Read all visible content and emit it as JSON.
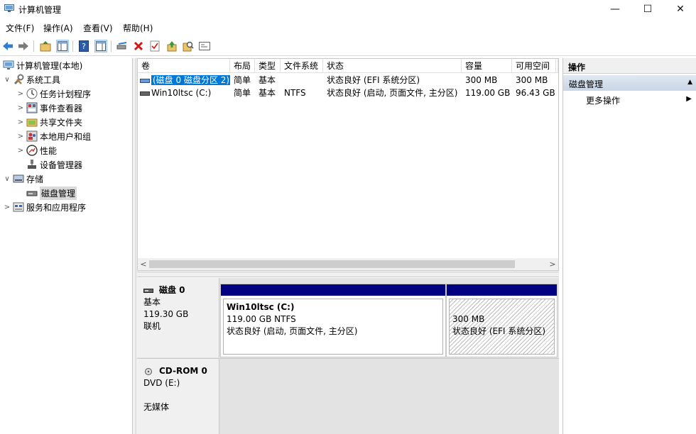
{
  "window": {
    "title": "计算机管理",
    "controls": {
      "minimize": "—",
      "maximize": "☐",
      "close": "✕"
    }
  },
  "menu": [
    "文件(F)",
    "操作(A)",
    "查看(V)",
    "帮助(H)"
  ],
  "toolbar": {
    "icons": [
      "back-icon",
      "forward-icon",
      "up-folder-icon",
      "show-hide-tree-icon",
      "help-icon",
      "properties-pane-icon",
      "connect-icon",
      "delete-icon",
      "check-icon",
      "import-icon",
      "search-icon",
      "console-icon"
    ]
  },
  "tree": {
    "items": [
      {
        "label": "计算机管理(本地)",
        "arrow": "",
        "icon": "computer-management-icon",
        "level": 0
      },
      {
        "label": "系统工具",
        "arrow": "∨",
        "icon": "system-tools-icon",
        "level": 1
      },
      {
        "label": "任务计划程序",
        "arrow": ">",
        "icon": "task-scheduler-icon",
        "level": 2
      },
      {
        "label": "事件查看器",
        "arrow": ">",
        "icon": "event-viewer-icon",
        "level": 2
      },
      {
        "label": "共享文件夹",
        "arrow": ">",
        "icon": "shared-folders-icon",
        "level": 2
      },
      {
        "label": "本地用户和组",
        "arrow": ">",
        "icon": "local-users-icon",
        "level": 2
      },
      {
        "label": "性能",
        "arrow": ">",
        "icon": "performance-icon",
        "level": 2
      },
      {
        "label": "设备管理器",
        "arrow": "",
        "icon": "device-manager-icon",
        "level": 2
      },
      {
        "label": "存储",
        "arrow": "∨",
        "icon": "storage-icon",
        "level": 1
      },
      {
        "label": "磁盘管理",
        "arrow": "",
        "icon": "disk-management-icon",
        "level": 2,
        "selected": true
      },
      {
        "label": "服务和应用程序",
        "arrow": ">",
        "icon": "services-apps-icon",
        "level": 1
      }
    ]
  },
  "volumes": {
    "columns": [
      "卷",
      "布局",
      "类型",
      "文件系统",
      "状态",
      "容量",
      "可用空间",
      ""
    ],
    "rows": [
      [
        "(磁盘 0 磁盘分区 2)",
        "简单",
        "基本",
        "",
        "状态良好 (EFI 系统分区)",
        "300 MB",
        "300 MB",
        ""
      ],
      [
        "Win10ltsc (C:)",
        "简单",
        "基本",
        "NTFS",
        "状态良好 (启动, 页面文件, 主分区)",
        "119.00 GB",
        "96.43 GB",
        ""
      ]
    ],
    "scroll_left": "<",
    "scroll_right": ">"
  },
  "disks": [
    {
      "name": "磁盘 0",
      "type": "基本",
      "size": "119.30 GB",
      "status": "联机",
      "partitions": [
        {
          "name": "Win10ltsc  (C:)",
          "size": "119.00 GB NTFS",
          "status": "状态良好 (启动, 页面文件, 主分区)"
        },
        {
          "name": "",
          "size": "300 MB",
          "status": "状态良好 (EFI 系统分区)"
        }
      ]
    },
    {
      "name": "CD-ROM 0",
      "type": "DVD (E:)",
      "size": "",
      "status": "无媒体"
    }
  ],
  "actions": {
    "header": "操作",
    "section": "磁盘管理",
    "collapse": "▲",
    "item": "更多操作",
    "item_arrow": "▶"
  }
}
